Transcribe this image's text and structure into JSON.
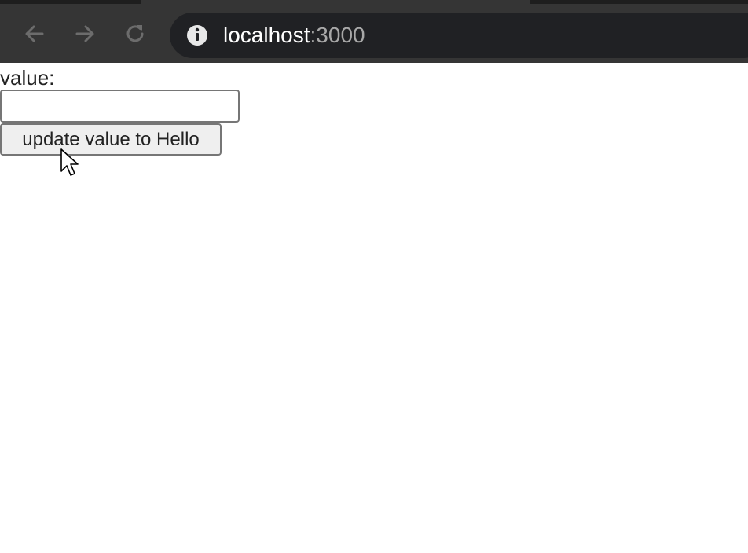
{
  "browser": {
    "url_host": "localhost",
    "url_port": ":3000",
    "icons": {
      "back": "back-arrow-icon",
      "forward": "forward-arrow-icon",
      "reload": "reload-icon",
      "site_info": "info-icon"
    }
  },
  "page": {
    "value_label": "value:",
    "value_input": "",
    "update_button_label": "update value to Hello"
  }
}
